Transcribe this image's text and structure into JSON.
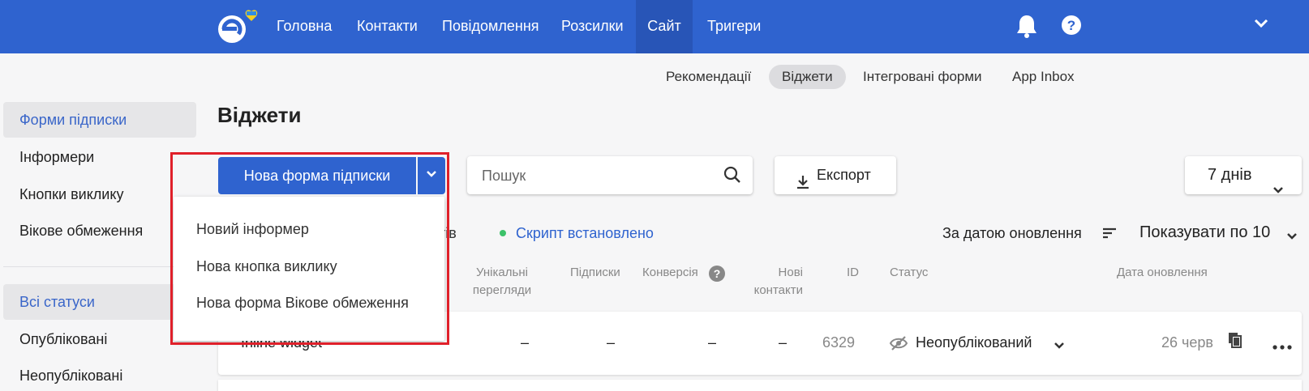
{
  "topnav": {
    "items": [
      {
        "label": "Головна"
      },
      {
        "label": "Контакти"
      },
      {
        "label": "Повідомлення"
      },
      {
        "label": "Розсилки"
      },
      {
        "label": "Сайт",
        "active": true
      },
      {
        "label": "Тригери"
      }
    ]
  },
  "subnav": {
    "items": [
      {
        "label": "Рекомендації"
      },
      {
        "label": "Віджети",
        "active": true
      },
      {
        "label": "Інтегровані форми"
      },
      {
        "label": "App Inbox"
      }
    ]
  },
  "sidebar": {
    "types": [
      {
        "label": "Форми підписки",
        "active": true
      },
      {
        "label": "Інформери"
      },
      {
        "label": "Кнопки виклику"
      },
      {
        "label": "Вікове обмеження"
      }
    ],
    "statuses": [
      {
        "label": "Всі статуси",
        "active": true
      },
      {
        "label": "Опубліковані"
      },
      {
        "label": "Неопубліковані"
      }
    ]
  },
  "page": {
    "title": "Віджети"
  },
  "toolbar": {
    "new_form_label": "Нова форма підписки",
    "search_placeholder": "Пошук",
    "export_label": "Експорт",
    "period_label": "7 днів"
  },
  "info": {
    "partial_text": "тів",
    "script_status": "Скрипт встановлено",
    "sort_label": "За датою оновлення",
    "per_page_label": "Показувати по 10"
  },
  "table": {
    "headers": {
      "unique_views": "Унікальні перегляди",
      "subscriptions": "Підписки",
      "conversion": "Конверсія",
      "new_contacts": "Нові контакти",
      "id": "ID",
      "status": "Статус",
      "updated": "Дата оновлення"
    },
    "rows": [
      {
        "name": "Inline widget",
        "unique_views": "–",
        "subscriptions": "–",
        "conversion": "–",
        "new_contacts": "–",
        "id": "6329",
        "status": "Неопублікований",
        "updated": "26 черв"
      }
    ]
  },
  "dropdown": {
    "items": [
      {
        "label": "Новий інформер"
      },
      {
        "label": "Нова кнопка виклику"
      },
      {
        "label": "Нова форма Вікове обмеження"
      }
    ]
  },
  "colors": {
    "brand": "#2f63cf",
    "highlight": "#e0202a",
    "script_ok": "#3cc26a"
  }
}
